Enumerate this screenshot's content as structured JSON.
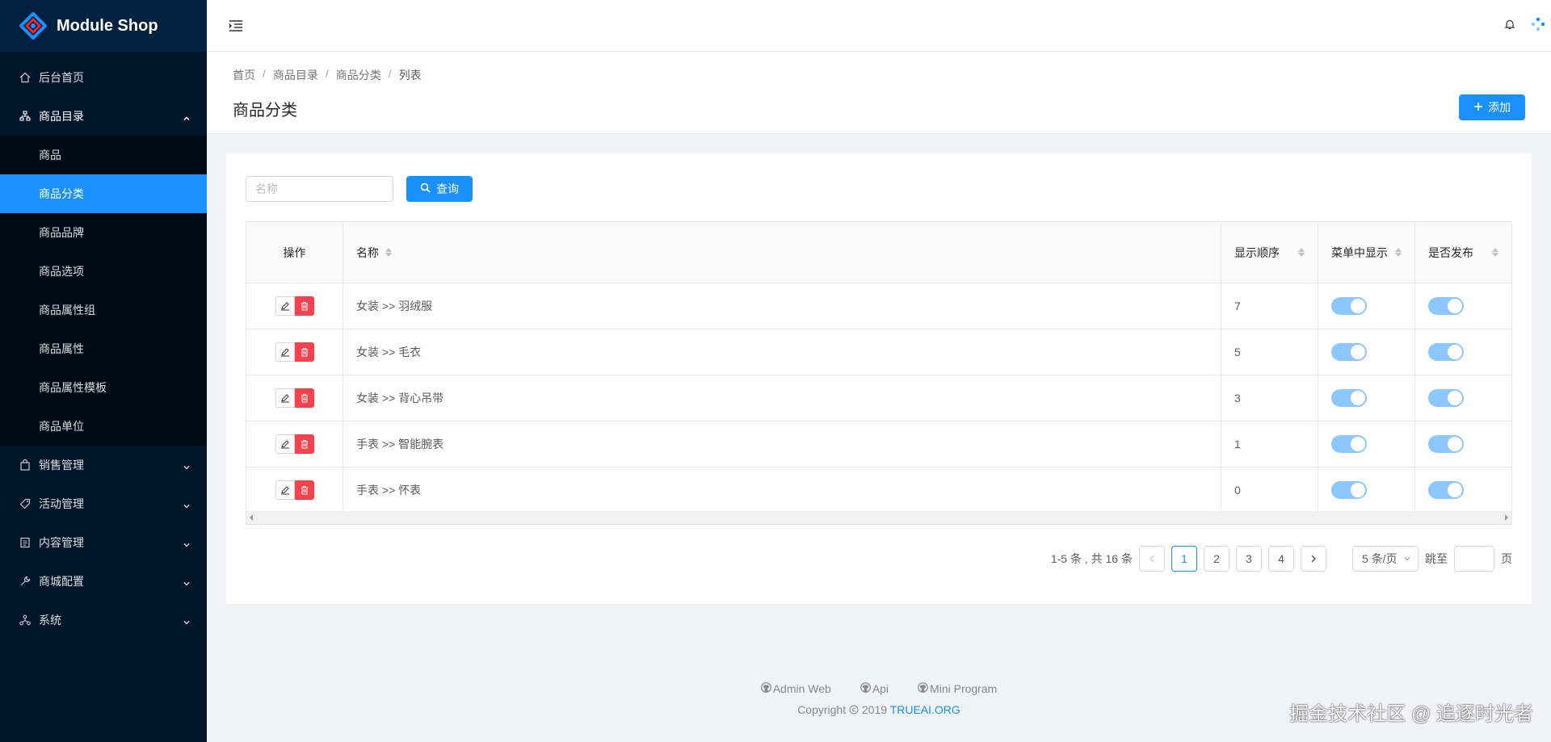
{
  "app": {
    "title": "Module Shop"
  },
  "sidebar": {
    "items": [
      {
        "label": "后台首页",
        "icon": "home-icon"
      },
      {
        "label": "商品目录",
        "icon": "cluster-icon",
        "expanded": true,
        "children": [
          {
            "label": "商品"
          },
          {
            "label": "商品分类",
            "active": true
          },
          {
            "label": "商品品牌"
          },
          {
            "label": "商品选项"
          },
          {
            "label": "商品属性组"
          },
          {
            "label": "商品属性"
          },
          {
            "label": "商品属性模板"
          },
          {
            "label": "商品单位"
          }
        ]
      },
      {
        "label": "销售管理",
        "icon": "shopping-icon"
      },
      {
        "label": "活动管理",
        "icon": "tag-icon"
      },
      {
        "label": "内容管理",
        "icon": "file-icon"
      },
      {
        "label": "商城配置",
        "icon": "tool-icon"
      },
      {
        "label": "系统",
        "icon": "apartment-icon"
      }
    ]
  },
  "breadcrumb": [
    "首页",
    "商品目录",
    "商品分类",
    "列表"
  ],
  "page": {
    "title": "商品分类",
    "add_label": "添加"
  },
  "search": {
    "placeholder": "名称",
    "value": "",
    "button_label": "查询"
  },
  "table": {
    "columns": [
      "操作",
      "名称",
      "显示顺序",
      "菜单中显示",
      "是否发布"
    ],
    "rows": [
      {
        "name": "女装 >> 羽绒服",
        "order": "7",
        "menu": true,
        "published": true
      },
      {
        "name": "女装 >> 毛衣",
        "order": "5",
        "menu": true,
        "published": true
      },
      {
        "name": "女装 >> 背心吊带",
        "order": "3",
        "menu": true,
        "published": true
      },
      {
        "name": "手表 >> 智能腕表",
        "order": "1",
        "menu": true,
        "published": true
      },
      {
        "name": "手表 >> 怀表",
        "order": "0",
        "menu": true,
        "published": true
      }
    ]
  },
  "pagination": {
    "total_text": "1-5 条 , 共 16 条",
    "pages": [
      "1",
      "2",
      "3",
      "4"
    ],
    "current": "1",
    "page_size": "5 条/页",
    "jump_label": "跳至",
    "jump_suffix": "页"
  },
  "footer": {
    "links": [
      "Admin Web",
      "Api",
      "Mini Program"
    ],
    "copyright_prefix": "Copyright",
    "copyright_year": "2019",
    "copyright_org": "TRUEAI.ORG"
  },
  "watermark": "掘金技术社区 @ 追逐时光者",
  "colors": {
    "primary": "#1890ff",
    "sidebar": "#001529",
    "danger": "#f5222d"
  }
}
